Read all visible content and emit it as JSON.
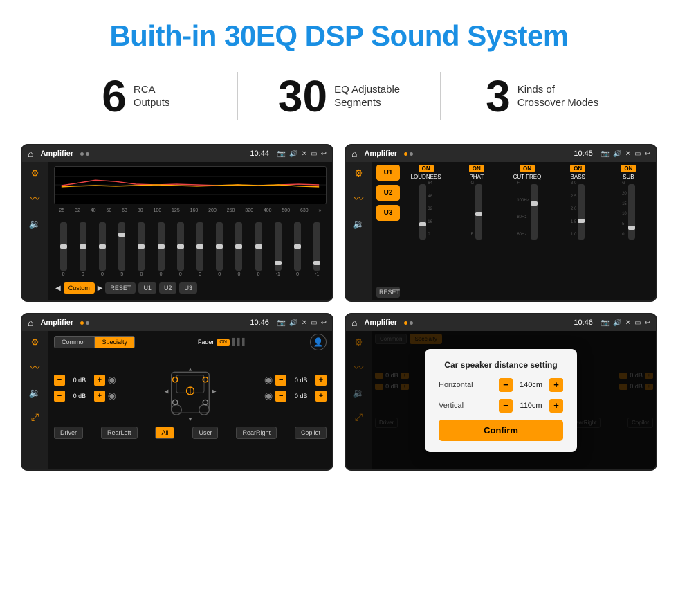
{
  "header": {
    "title": "Buith-in 30EQ DSP Sound System"
  },
  "stats": [
    {
      "number": "6",
      "label": "RCA\nOutputs"
    },
    {
      "number": "30",
      "label": "EQ Adjustable\nSegments"
    },
    {
      "number": "3",
      "label": "Kinds of\nCrossover Modes"
    }
  ],
  "screens": [
    {
      "id": "eq-screen",
      "statusTitle": "Amplifier",
      "statusTime": "10:44",
      "type": "eq"
    },
    {
      "id": "crossover-screen",
      "statusTitle": "Amplifier",
      "statusTime": "10:45",
      "type": "crossover"
    },
    {
      "id": "fader-screen",
      "statusTitle": "Amplifier",
      "statusTime": "10:46",
      "type": "fader"
    },
    {
      "id": "dialog-screen",
      "statusTitle": "Amplifier",
      "statusTime": "10:46",
      "type": "dialog"
    }
  ],
  "eq": {
    "frequencies": [
      "25",
      "32",
      "40",
      "50",
      "63",
      "80",
      "100",
      "125",
      "160",
      "200",
      "250",
      "320",
      "400",
      "500",
      "630"
    ],
    "values": [
      "0",
      "0",
      "0",
      "5",
      "0",
      "0",
      "0",
      "0",
      "0",
      "0",
      "0",
      "-1",
      "0",
      "-1"
    ],
    "presets": [
      "Custom",
      "RESET",
      "U1",
      "U2",
      "U3"
    ]
  },
  "crossover": {
    "channels": [
      "LOUDNESS",
      "PHAT",
      "CUT FREQ",
      "BASS",
      "SUB"
    ],
    "uPresets": [
      "U1",
      "U2",
      "U3"
    ]
  },
  "fader": {
    "tabs": [
      "Common",
      "Specialty"
    ],
    "faderLabel": "Fader",
    "bottomButtons": [
      "Driver",
      "RearLeft",
      "All",
      "User",
      "RearRight",
      "Copilot"
    ]
  },
  "dialog": {
    "title": "Car speaker distance setting",
    "horizontal": {
      "label": "Horizontal",
      "value": "140cm"
    },
    "vertical": {
      "label": "Vertical",
      "value": "110cm"
    },
    "confirmLabel": "Confirm"
  },
  "colors": {
    "orange": "#f90",
    "blue": "#1a8fe3",
    "dark": "#1a1a1a",
    "darkBg": "#111"
  }
}
